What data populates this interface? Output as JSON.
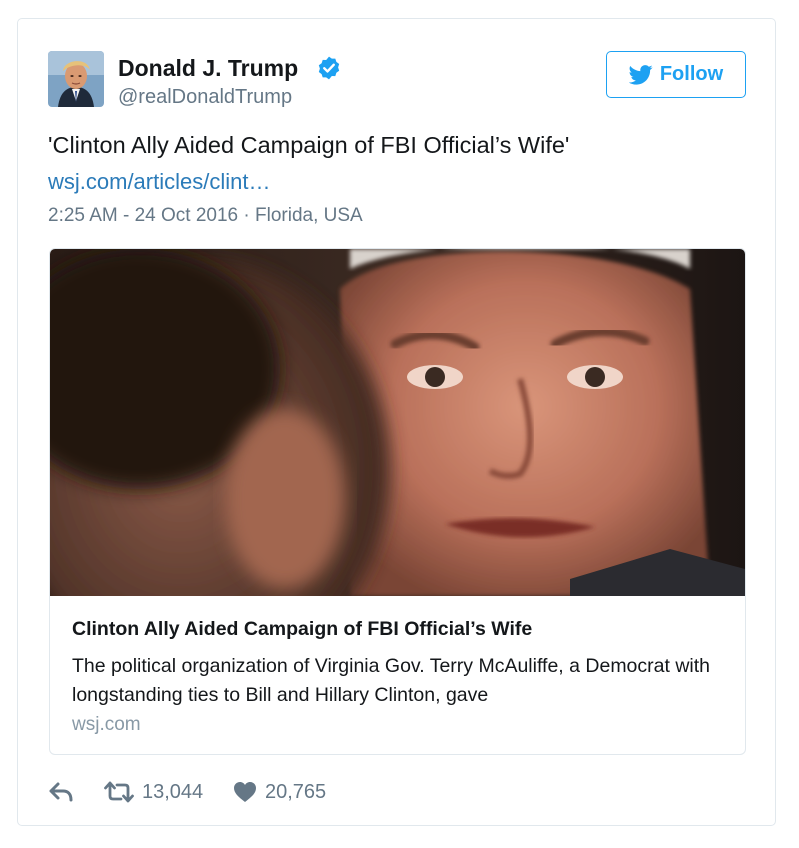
{
  "tweet": {
    "author_name": "Donald J. Trump",
    "author_handle": "@realDonaldTrump",
    "verified_icon": "verified-badge-icon",
    "follow_label": "Follow",
    "text": "'Clinton Ally Aided Campaign of FBI Official’s Wife'",
    "link_text": "wsj.com/articles/clint…",
    "time": "2:25 AM - 24 Oct 2016",
    "separator": "·",
    "location": "Florida, USA"
  },
  "card": {
    "title": "Clinton Ally Aided Campaign of FBI Official’s Wife",
    "description": "The political organization of Virginia Gov. Terry McAuliffe, a Democrat with longstanding ties to Bill and Hillary Clinton, gave",
    "domain": "wsj.com"
  },
  "actions": {
    "reply_icon": "reply-icon",
    "retweet_icon": "retweet-icon",
    "retweet_count": "13,044",
    "like_icon": "heart-icon",
    "like_count": "20,765"
  },
  "colors": {
    "brand_blue": "#1da1f2",
    "link_blue": "#2b7bb9",
    "text": "#14171a",
    "muted": "#657786",
    "border": "#e1e8ed"
  }
}
